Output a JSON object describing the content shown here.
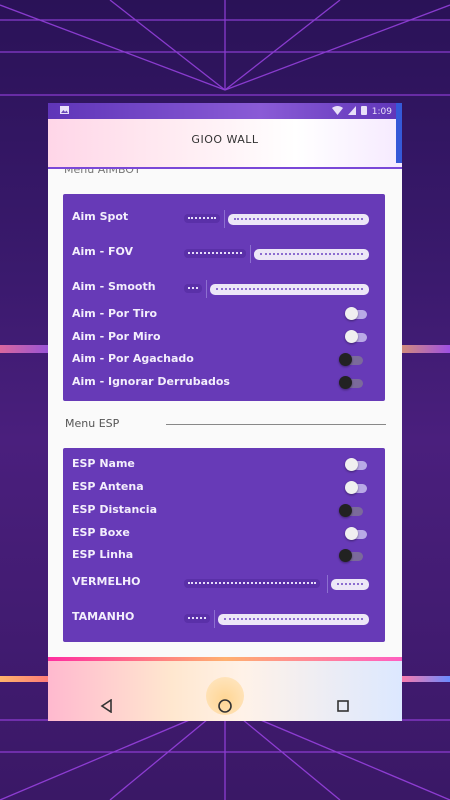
{
  "status_bar": {
    "time": "1:09"
  },
  "app": {
    "title": "GIOO WALL"
  },
  "menus": {
    "aimbot_title": "Menu AIMBOT",
    "esp_title": "Menu ESP"
  },
  "aim": {
    "spot": {
      "label": "Aim Spot",
      "value_fraction": 0.2
    },
    "fov": {
      "label": "Aim - FOV",
      "value_fraction": 0.36
    },
    "smooth": {
      "label": "Aim - Smooth",
      "value_fraction": 0.12
    },
    "toggles": [
      {
        "label": "Aim - Por Tiro",
        "on": true
      },
      {
        "label": "Aim - Por Miro",
        "on": true
      },
      {
        "label": "Aim - Por Agachado",
        "on": false
      },
      {
        "label": "Aim - Ignorar Derrubados",
        "on": false
      }
    ]
  },
  "esp": {
    "toggles": [
      {
        "label": "ESP Name",
        "on": true
      },
      {
        "label": "ESP Antena",
        "on": true
      },
      {
        "label": "ESP Distancia",
        "on": false
      },
      {
        "label": "ESP Boxe",
        "on": true
      },
      {
        "label": "ESP Linha",
        "on": false
      }
    ],
    "vermelho": {
      "label": "VERMELHO",
      "value_fraction": 0.78
    },
    "tamanho": {
      "label": "TAMANHO",
      "value_fraction": 0.17
    }
  },
  "icons": {
    "nav_back": "back-triangle-icon",
    "nav_home": "home-circle-icon",
    "nav_recents": "recents-square-icon"
  },
  "colors": {
    "panel": "#673ab7",
    "accent": "#7a48d8"
  }
}
